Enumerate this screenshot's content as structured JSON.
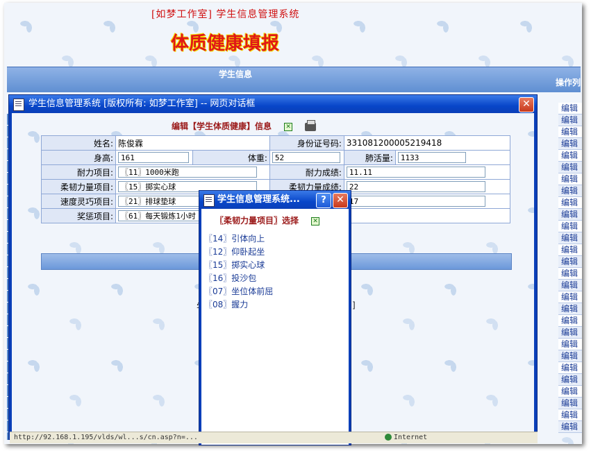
{
  "app": {
    "top_title": "[如梦工作室] 学生信息管理系统",
    "page_title": "体质健康填报"
  },
  "background_table": {
    "group_header": "学生信息",
    "ops_header": "操作列",
    "edit_label": "编辑",
    "edit_count": 28
  },
  "dialog": {
    "title": "学生信息管理系统 [版权所有: 如梦工作室] -- 网页对话框",
    "heading": "编辑【学生体质健康】信息",
    "fields": {
      "name_label": "姓名:",
      "name_value": "陈俊霖",
      "id_label": "身份证号码:",
      "id_value": "331081200005219418",
      "height_label": "身高:",
      "height_value": "161",
      "weight_label": "体重:",
      "weight_value": "52",
      "lung_label": "肺活量:",
      "lung_value": "1133",
      "endurance_item_label": "耐力项目:",
      "endurance_item_value": "〖11〗1000米跑",
      "endurance_score_label": "耐力成绩:",
      "endurance_score_value": "11.11",
      "flex_item_label": "柔韧力量项目:",
      "flex_item_value": "〖15〗掷实心球",
      "flex_score_label": "柔韧力量成绩:",
      "flex_score_value": "22",
      "speed_item_label": "速度灵巧项目:",
      "speed_item_value": "〖21〗排球垫球",
      "speed_score_value": "17",
      "reward_label": "奖惩项目:",
      "reward_value": "〖61〗每天锻炼1小时"
    },
    "bottom_left": "学",
    "bottom_right": "]"
  },
  "popup": {
    "title": "学生信息管理系统...",
    "heading": "〖柔韧力量项目〗选择",
    "options": [
      "〖14〗引体向上",
      "〖12〗仰卧起坐",
      "〖15〗掷实心球",
      "〖16〗投沙包",
      "〖07〗坐位体前屈",
      "〖08〗握力"
    ]
  },
  "statusbar": {
    "url": "http://92.168.1.195/vlds/wl...s/cn.asp?n=...",
    "zone": "Internet"
  }
}
